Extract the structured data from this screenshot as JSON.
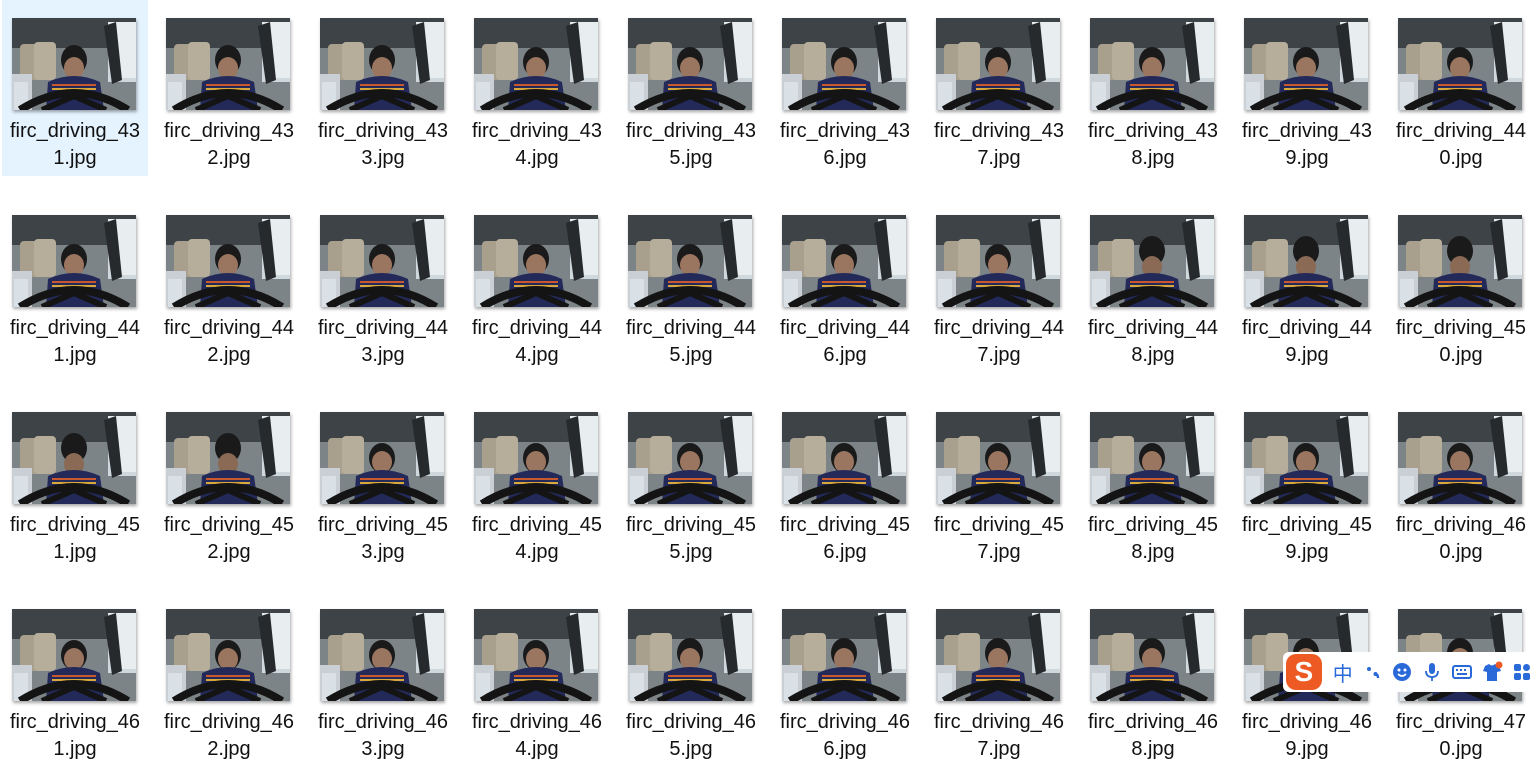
{
  "files": [
    {
      "name": "firc_driving_431.jpg",
      "selected": true
    },
    {
      "name": "firc_driving_432.jpg"
    },
    {
      "name": "firc_driving_433.jpg"
    },
    {
      "name": "firc_driving_434.jpg"
    },
    {
      "name": "firc_driving_435.jpg"
    },
    {
      "name": "firc_driving_436.jpg"
    },
    {
      "name": "firc_driving_437.jpg"
    },
    {
      "name": "firc_driving_438.jpg"
    },
    {
      "name": "firc_driving_439.jpg"
    },
    {
      "name": "firc_driving_440.jpg"
    },
    {
      "name": "firc_driving_441.jpg"
    },
    {
      "name": "firc_driving_442.jpg"
    },
    {
      "name": "firc_driving_443.jpg"
    },
    {
      "name": "firc_driving_444.jpg"
    },
    {
      "name": "firc_driving_445.jpg"
    },
    {
      "name": "firc_driving_446.jpg"
    },
    {
      "name": "firc_driving_447.jpg"
    },
    {
      "name": "firc_driving_448.jpg"
    },
    {
      "name": "firc_driving_449.jpg"
    },
    {
      "name": "firc_driving_450.jpg"
    },
    {
      "name": "firc_driving_451.jpg"
    },
    {
      "name": "firc_driving_452.jpg"
    },
    {
      "name": "firc_driving_453.jpg"
    },
    {
      "name": "firc_driving_454.jpg"
    },
    {
      "name": "firc_driving_455.jpg"
    },
    {
      "name": "firc_driving_456.jpg"
    },
    {
      "name": "firc_driving_457.jpg"
    },
    {
      "name": "firc_driving_458.jpg"
    },
    {
      "name": "firc_driving_459.jpg"
    },
    {
      "name": "firc_driving_460.jpg"
    },
    {
      "name": "firc_driving_461.jpg"
    },
    {
      "name": "firc_driving_462.jpg"
    },
    {
      "name": "firc_driving_463.jpg"
    },
    {
      "name": "firc_driving_464.jpg"
    },
    {
      "name": "firc_driving_465.jpg"
    },
    {
      "name": "firc_driving_466.jpg"
    },
    {
      "name": "firc_driving_467.jpg"
    },
    {
      "name": "firc_driving_468.jpg"
    },
    {
      "name": "firc_driving_469.jpg"
    },
    {
      "name": "firc_driving_470.jpg"
    }
  ],
  "ime_toolbar": {
    "logo": "S",
    "language": "中",
    "icons": [
      "punctuation-icon",
      "emoji-icon",
      "microphone-icon",
      "keyboard-icon",
      "skin-icon",
      "toolbox-icon"
    ]
  },
  "colors": {
    "selection": "#e5f3ff",
    "ime_accent": "#2a6ad8",
    "ime_logo": "#ee5a24"
  }
}
